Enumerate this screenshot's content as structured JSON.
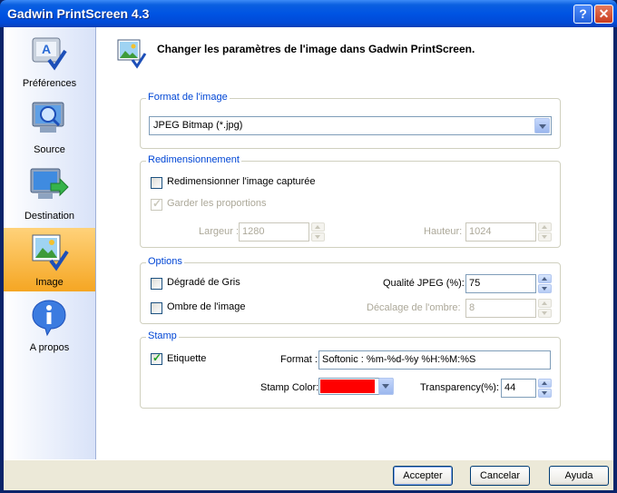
{
  "window": {
    "title": "Gadwin PrintScreen 4.3",
    "help_glyph": "?",
    "close_glyph": "✕"
  },
  "sidebar": {
    "items": [
      {
        "label": "Préférences",
        "icon": "preferences-icon",
        "selected": false
      },
      {
        "label": "Source",
        "icon": "source-magnifier-icon",
        "selected": false
      },
      {
        "label": "Destination",
        "icon": "destination-monitor-icon",
        "selected": false
      },
      {
        "label": "Image",
        "icon": "image-icon",
        "selected": true
      },
      {
        "label": "A propos",
        "icon": "info-icon",
        "selected": false
      }
    ]
  },
  "header": {
    "text": "Changer les paramètres de l'image dans Gadwin PrintScreen."
  },
  "format": {
    "title": "Format de l'image",
    "selected": "JPEG Bitmap (*.jpg)"
  },
  "resize": {
    "title": "Redimensionnement",
    "resize_label": "Redimensionner l'image capturée",
    "resize_checked": false,
    "keep_label": "Garder les proportions",
    "keep_checked": true,
    "width_label": "Largeur :",
    "width_value": "1280",
    "height_label": "Hauteur:",
    "height_value": "1024"
  },
  "options": {
    "title": "Options",
    "grey_label": "Dégradé de Gris",
    "grey_checked": false,
    "quality_label": "Qualité JPEG (%):",
    "quality_value": "75",
    "shadow_label": "Ombre de l'image",
    "shadow_checked": false,
    "offset_label": "Décalage de l'ombre:",
    "offset_value": "8"
  },
  "stamp": {
    "title": "Stamp",
    "label_label": "Etiquette",
    "label_checked": true,
    "format_label": "Format :",
    "format_value": "Softonic : %m-%d-%y %H:%M:%S",
    "color_label": "Stamp Color:",
    "color_value": "#ff0000",
    "transparency_label": "Transparency(%):",
    "transparency_value": "44"
  },
  "buttons": {
    "accept": "Accepter",
    "cancel": "Cancelar",
    "help": "Ayuda"
  },
  "colors": {
    "titlebar": "#0054e3",
    "selected_item": "#f5a623",
    "group_title": "#0046d5"
  }
}
